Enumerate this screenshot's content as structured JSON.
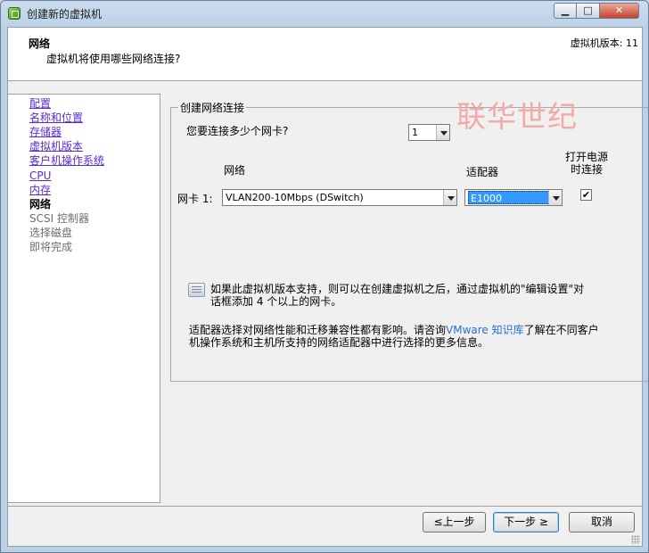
{
  "window": {
    "title": "创建新的虚拟机",
    "icon": "vsphere-app-icon",
    "controls": {
      "minimize": "▁",
      "maximize": "□",
      "close": "✕"
    }
  },
  "header": {
    "title": "网络",
    "subtitle": "虚拟机将使用哪些网络连接?",
    "version": "虚拟机版本: 11"
  },
  "sidebar": {
    "items": [
      {
        "label": "配置",
        "state": "link"
      },
      {
        "label": "名称和位置",
        "state": "link"
      },
      {
        "label": "存储器",
        "state": "link"
      },
      {
        "label": "虚拟机版本",
        "state": "link"
      },
      {
        "label": "客户机操作系统",
        "state": "link"
      },
      {
        "label": "CPU",
        "state": "link"
      },
      {
        "label": "内存",
        "state": "link"
      },
      {
        "label": "网络",
        "state": "current"
      },
      {
        "label": "SCSI 控制器",
        "state": "disabled"
      },
      {
        "label": "选择磁盘",
        "state": "disabled"
      },
      {
        "label": "即将完成",
        "state": "disabled"
      }
    ]
  },
  "main": {
    "group_title": "创建网络连接",
    "watermark": "联华世纪",
    "nic_count_label": "您要连接多少个网卡?",
    "nic_count_value": "1",
    "col_network": "网络",
    "col_adapter": "适配器",
    "col_power_line1": "打开电源",
    "col_power_line2": "时连接",
    "nic_row": {
      "label": "网卡 1:",
      "network_value": "VLAN200-10Mbps (DSwitch)",
      "adapter_value": "E1000",
      "connect_at_power_on": true,
      "check_glyph": "✔"
    },
    "info_line1": "如果此虚拟机版本支持，则可以在创建虚拟机之后，通过虚拟机的\"编辑设置\"对",
    "info_line2": "话框添加 4 个以上的网卡。",
    "adapter_note_part1": "适配器选择对网络性能和迁移兼容性都有影响。请咨询",
    "adapter_note_link": "VMware 知识库",
    "adapter_note_part2": "了解在不同客户",
    "adapter_note_line2": "机操作系统和主机所支持的网络适配器中进行选择的更多信息。"
  },
  "footer": {
    "back": "≤上一步",
    "next": "下一步 ≥",
    "cancel": "取消"
  },
  "colors": {
    "link": "#5a2bd0",
    "kb_link": "#2a6fd6",
    "selection": "#3399ff",
    "watermark": "#f4a9a9"
  }
}
